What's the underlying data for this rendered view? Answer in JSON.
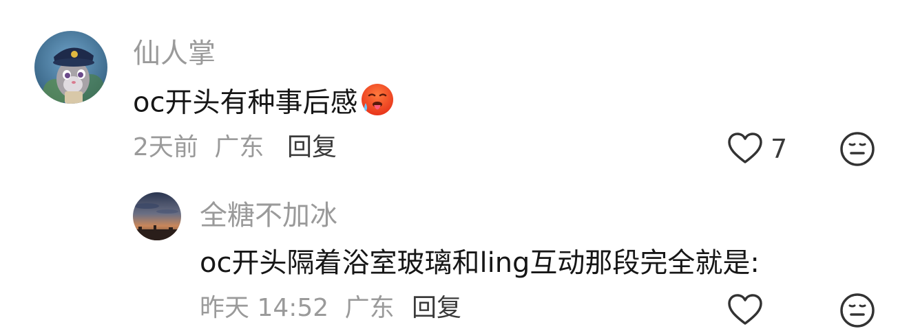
{
  "comments": [
    {
      "username": "仙人掌",
      "content": "oc开头有种事后感",
      "emoji": "hot-face-emoji",
      "time": "2天前",
      "location": "广东",
      "reply_label": "回复",
      "likes": "7"
    }
  ],
  "replies": [
    {
      "username": "全糖不加冰",
      "content": "oc开头隔着浴室玻璃和ling互动那段完全就是:",
      "time": "昨天 14:52",
      "location": "广东",
      "reply_label": "回复",
      "likes": ""
    }
  ],
  "colors": {
    "meta_text": "#9a9a9a",
    "body_text": "#161616",
    "icon_stroke": "#333333"
  }
}
